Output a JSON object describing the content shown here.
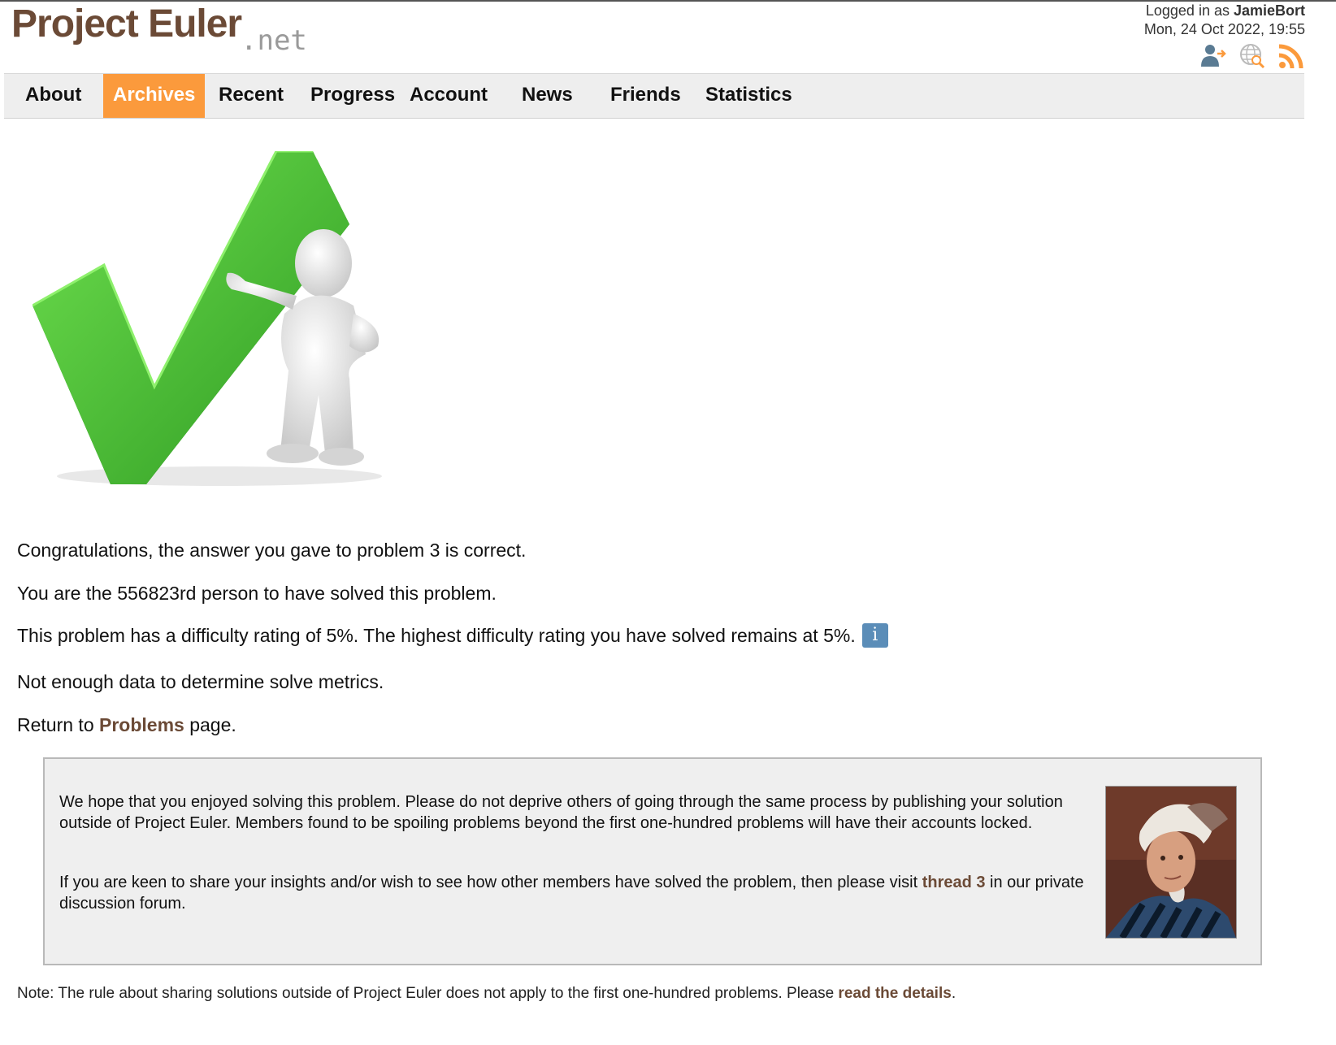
{
  "header": {
    "logo_main": "Project Euler",
    "logo_net": ".net",
    "logged_in_prefix": "Logged in as ",
    "username": "JamieBort",
    "datetime": "Mon, 24 Oct 2022, 19:55",
    "icons": [
      "account-icon",
      "globe-search-icon",
      "rss-feed-icon"
    ]
  },
  "nav": {
    "items": [
      {
        "label": "About"
      },
      {
        "label": "Archives",
        "active": true
      },
      {
        "label": "Recent"
      },
      {
        "label": "Progress"
      },
      {
        "label": "Account"
      },
      {
        "label": "News"
      },
      {
        "label": "Friends"
      },
      {
        "label": "Statistics"
      }
    ],
    "active_color": "#fb9a3c"
  },
  "result": {
    "congrats": "Congratulations, the answer you gave to problem 3 is correct.",
    "solver_count": "You are the 556823rd person to have solved this problem.",
    "difficulty": "This problem has a difficulty rating of 5%. The highest difficulty rating you have solved remains at 5%.",
    "info_glyph": "i",
    "metrics": "Not enough data to determine solve metrics.",
    "return_prefix": "Return to ",
    "return_link": "Problems",
    "return_suffix": " page."
  },
  "notice": {
    "para1": "We hope that you enjoyed solving this problem. Please do not deprive others of going through the same process by publishing your solution outside of Project Euler. Members found to be spoiling problems beyond the first one-hundred problems will have their accounts locked.",
    "para2_prefix": "If you are keen to share your insights and/or wish to see how other members have solved the problem, then please visit ",
    "para2_link": "thread 3",
    "para2_suffix": " in our private discussion forum."
  },
  "note": {
    "prefix": "Note: The rule about sharing solutions outside of Project Euler does not apply to the first one-hundred problems. Please ",
    "link": "read the details",
    "suffix": "."
  },
  "colors": {
    "brand": "#6b4a36",
    "link": "#6b4a36",
    "checkmark": "#4cc43a",
    "info_button": "#5b8db8"
  }
}
